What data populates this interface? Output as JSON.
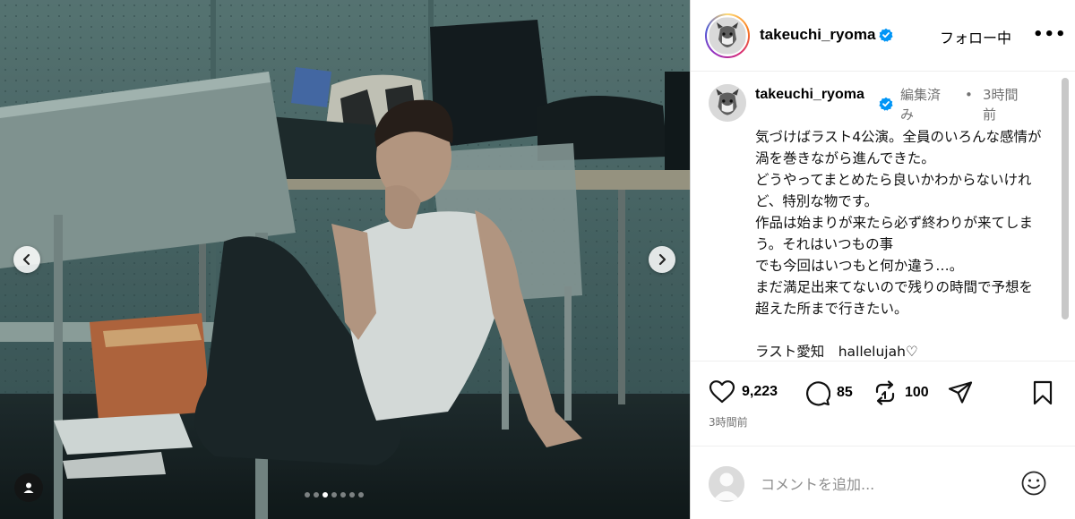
{
  "post": {
    "username": "takeuchi_ryoma",
    "follow_label": "フォロー中",
    "more_label": "•••"
  },
  "caption": {
    "username": "takeuchi_ryoma",
    "edited_label": "編集済み",
    "separator": "•",
    "time": "3時間前",
    "text": "気づけばラスト4公演。全員のいろんな感情が渦を巻きながら進んできた。\nどうやってまとめたら良いかわからないけれど、特別な物です。\n作品は始まりが来たら必ず終わりが来てしまう。それはいつもの事\nでも今回はいつもと何か違う…。\nまだ満足出来てないので残りの時間で予想を超えた所まで行きたい。\n\nラスト愛知　hallelujah♡"
  },
  "stats": {
    "likes": "9,223",
    "comments": "85",
    "reposts": "100",
    "posted": "3時間前"
  },
  "comment_box": {
    "placeholder": "コメントを追加..."
  },
  "carousel": {
    "total_slides": 7,
    "active_index": 2
  },
  "icons": {
    "prev": "chevron-left-icon",
    "next": "chevron-right-icon",
    "tag": "user-tag-icon",
    "verified": "verified-badge-icon",
    "like": "heart-icon",
    "comment": "comment-bubble-icon",
    "repost": "repost-icon",
    "share": "paper-plane-icon",
    "save": "bookmark-icon",
    "emoji": "emoji-icon"
  },
  "colors": {
    "verified": "#0095f6",
    "muted": "#737373"
  }
}
